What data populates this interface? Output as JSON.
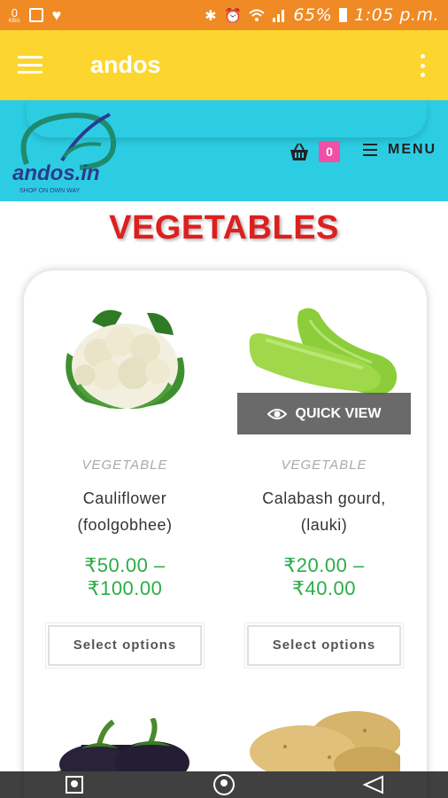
{
  "status_bar": {
    "data_label": "0",
    "data_unit": "KB/s",
    "battery": "65%",
    "time": "1:05 p.m."
  },
  "app_bar": {
    "title": "andos"
  },
  "header": {
    "logo_text": "andos.in",
    "logo_tagline": "SHOP ON OWN WAY",
    "cart_count": "0",
    "menu_label": "MENU"
  },
  "page": {
    "title": "VEGETABLES"
  },
  "products": [
    {
      "category": "VEGETABLE",
      "name_line1": "Cauliflower",
      "name_line2": "(foolgobhee)",
      "price_line1": "₹50.00 –",
      "price_line2": "₹100.00",
      "button": "Select options"
    },
    {
      "category": "VEGETABLE",
      "name_line1": "Calabash gourd,",
      "name_line2": "(lauki)",
      "price_line1": "₹20.00 –",
      "price_line2": "₹40.00",
      "button": "Select options"
    }
  ],
  "quick_view": {
    "label": "QUICK VIEW"
  },
  "colors": {
    "status_bar": "#f08a24",
    "app_bar": "#fcd62e",
    "site_header": "#2ccde3",
    "title_red": "#dd1f1f",
    "price_green": "#2aad46",
    "cart_badge": "#f24ea8"
  }
}
